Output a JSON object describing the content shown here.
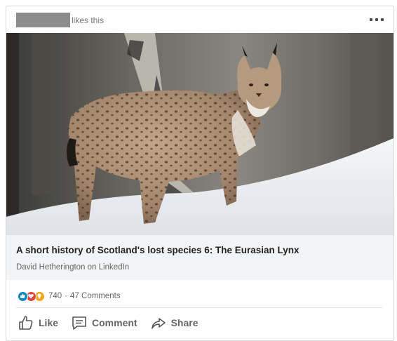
{
  "header": {
    "activity_text": "likes this",
    "more_icon": "ellipsis-icon"
  },
  "post": {
    "image_alt": "Eurasian lynx standing in snow beside a tree",
    "title": "A short history of Scotland's lost species 6: The Eurasian Lynx",
    "source": "David Hetherington on LinkedIn"
  },
  "social": {
    "reactions": [
      {
        "icon": "like-reaction-icon",
        "color": "#0a86c8"
      },
      {
        "icon": "love-reaction-icon",
        "color": "#e0443a"
      },
      {
        "icon": "insightful-reaction-icon",
        "color": "#f2a51a"
      }
    ],
    "reaction_count": "740",
    "separator": "·",
    "comments": "47 Comments"
  },
  "actions": {
    "like": "Like",
    "comment": "Comment",
    "share": "Share"
  }
}
